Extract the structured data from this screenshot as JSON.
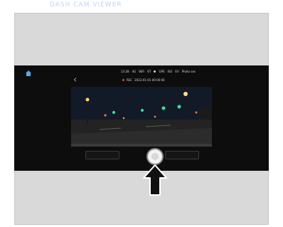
{
  "header": {
    "title": "DASH CAM VIEWER"
  },
  "app_bar": {
    "status_items": [
      "13:28",
      "4G",
      "WiFi",
      "BT",
      "GPS",
      "ISO",
      "EV",
      "Photo sec"
    ],
    "rec_label": "REC",
    "rec_text": "2023-01-01  00:00:00"
  },
  "colors": {
    "app_background": "#0d0d0d",
    "frame_background": "#d9d9d9",
    "rec_indicator": "#e04545",
    "header_text": "#bcd6f2"
  },
  "icons": {
    "home": "home-icon",
    "back": "back-icon",
    "shutter": "shutter-button",
    "pointer": "up-arrow-icon"
  }
}
